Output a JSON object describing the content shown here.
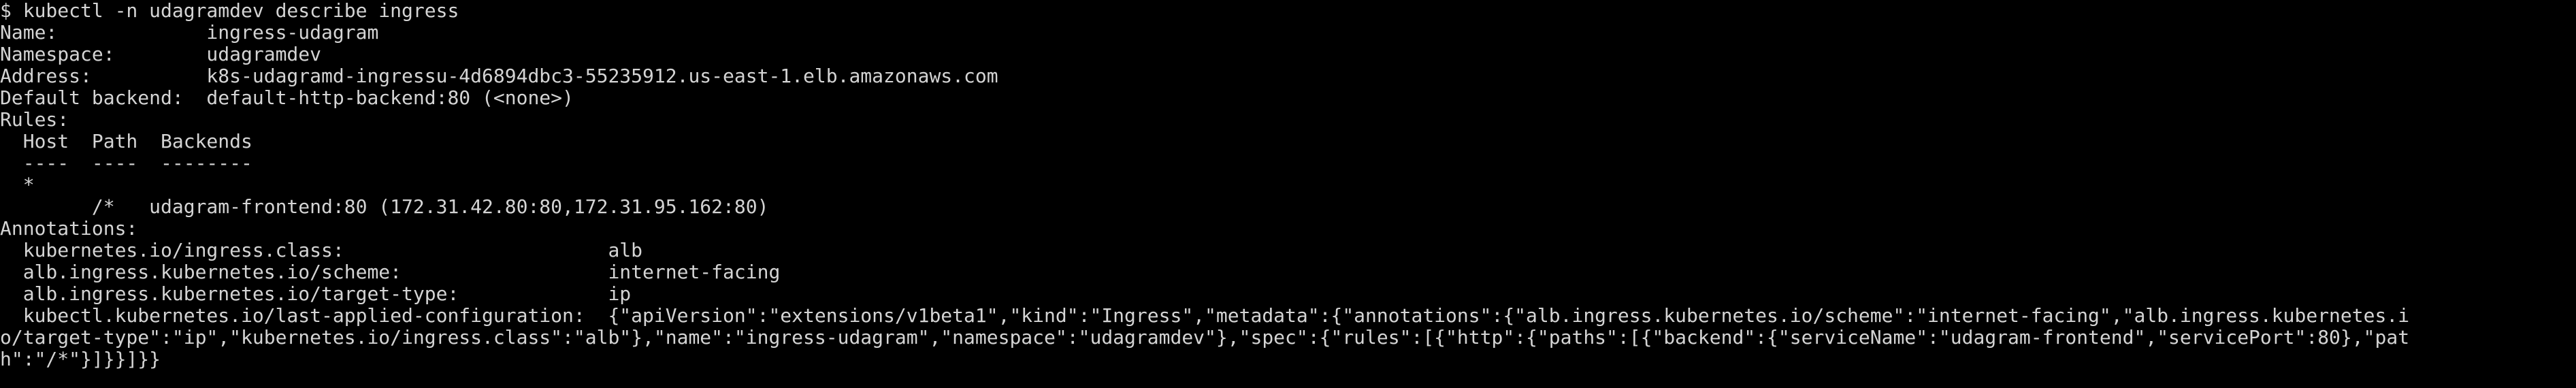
{
  "terminal": {
    "foreground": "#d4d4d4",
    "background": "#000000",
    "lines": [
      "$ kubectl -n udagramdev describe ingress",
      "Name:             ingress-udagram",
      "Namespace:        udagramdev",
      "Address:          k8s-udagramd-ingressu-4d6894dbc3-55235912.us-east-1.elb.amazonaws.com",
      "Default backend:  default-http-backend:80 (<none>)",
      "Rules:",
      "  Host  Path  Backends",
      "  ----  ----  --------",
      "  *",
      "        /*   udagram-frontend:80 (172.31.42.80:80,172.31.95.162:80)",
      "Annotations:",
      "  kubernetes.io/ingress.class:                       alb",
      "  alb.ingress.kubernetes.io/scheme:                  internet-facing",
      "  alb.ingress.kubernetes.io/target-type:             ip",
      "  kubectl.kubernetes.io/last-applied-configuration:  {\"apiVersion\":\"extensions/v1beta1\",\"kind\":\"Ingress\",\"metadata\":{\"annotations\":{\"alb.ingress.kubernetes.io/scheme\":\"internet-facing\",\"alb.ingress.kubernetes.i",
      "o/target-type\":\"ip\",\"kubernetes.io/ingress.class\":\"alb\"},\"name\":\"ingress-udagram\",\"namespace\":\"udagramdev\"},\"spec\":{\"rules\":[{\"http\":{\"paths\":[{\"backend\":{\"serviceName\":\"udagram-frontend\",\"servicePort\":80},\"pat",
      "h\":\"/*\"}]}}]}}"
    ]
  }
}
